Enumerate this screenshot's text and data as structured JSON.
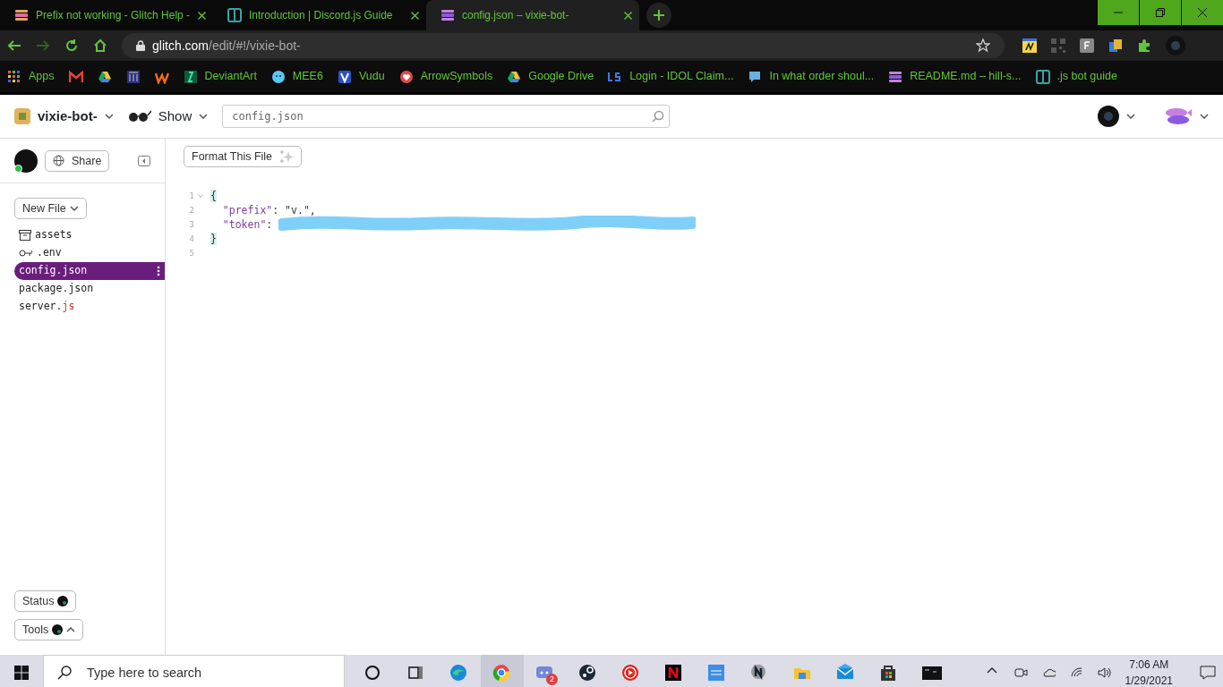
{
  "browser": {
    "tabs": [
      {
        "title": "Prefix not working - Glitch Help -",
        "selected": false
      },
      {
        "title": "Introduction | Discord.js Guide",
        "selected": false
      },
      {
        "title": "config.json – vixie-bot-",
        "selected": true
      }
    ],
    "url_host": "glitch.com",
    "url_path": "/edit/#!/vixie-bot-",
    "bookmarks": [
      "Apps",
      "DeviantArt",
      "MEE6",
      "Vudu",
      "ArrowSymbols",
      "Google Drive",
      "Login - IDOL Claim...",
      "In what order shoul...",
      "README.md – hill-s...",
      ".js bot guide"
    ]
  },
  "header": {
    "project": "vixie-bot-",
    "show": "Show",
    "file_search": {
      "placeholder": "config.json"
    }
  },
  "sidebar": {
    "share": "Share",
    "new_file": "New File",
    "files": [
      {
        "name": "assets",
        "kind": "folder",
        "selected": false
      },
      {
        "name": ".env",
        "kind": "env",
        "selected": false
      },
      {
        "name": "config.json",
        "kind": "file",
        "selected": true
      },
      {
        "name": "package.json",
        "kind": "file",
        "selected": false
      },
      {
        "name": "server.",
        "ext": "js",
        "kind": "file",
        "selected": false
      }
    ],
    "status": "Status",
    "tools": "Tools"
  },
  "editor": {
    "format_button": "Format This File",
    "lines": [
      {
        "number": "1",
        "foldable": true,
        "tokens": [
          {
            "text": "{",
            "kind": "bracket"
          }
        ]
      },
      {
        "number": "2",
        "foldable": false,
        "tokens": [
          {
            "text": "  \"prefix\"",
            "kind": "key"
          },
          {
            "text": ": ",
            "kind": "punct"
          },
          {
            "text": "\"v.\"",
            "kind": "string"
          },
          {
            "text": ",",
            "kind": "punct"
          }
        ]
      },
      {
        "number": "3",
        "foldable": false,
        "tokens": [
          {
            "text": "  \"token\"",
            "kind": "key"
          },
          {
            "text": ": ",
            "kind": "punct"
          }
        ],
        "redacted": true
      },
      {
        "number": "4",
        "foldable": false,
        "tokens": [
          {
            "text": "}",
            "kind": "bracket"
          }
        ]
      },
      {
        "number": "5",
        "foldable": false
      }
    ]
  },
  "taskbar": {
    "search_placeholder": "Type here to search",
    "chat_badge": "2",
    "time": "7:06 AM",
    "date": "1/29/2021"
  }
}
